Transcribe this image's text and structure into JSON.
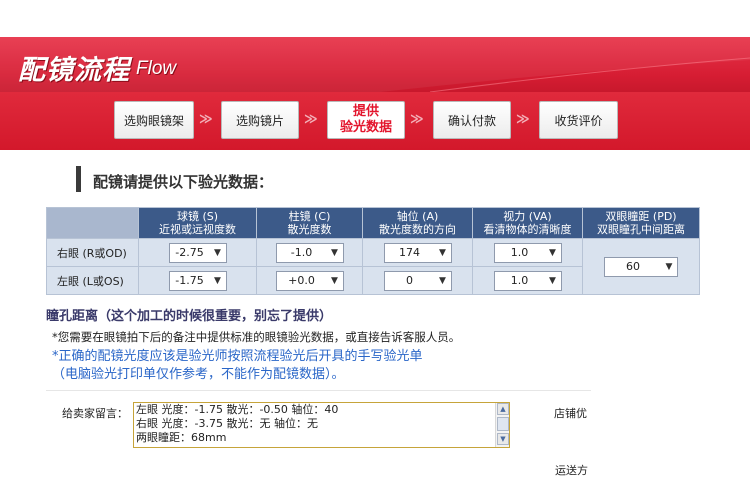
{
  "header": {
    "title": "配镜流程",
    "subtitle": "Flow",
    "colors": {
      "banner": "#d61d33",
      "active_step_text": "#e3152d"
    }
  },
  "steps": [
    {
      "label": "选购眼镜架",
      "active": false
    },
    {
      "label": "选购镜片",
      "active": false
    },
    {
      "label_line1": "提供",
      "label_line2": "验光数据",
      "active": true
    },
    {
      "label": "确认付款",
      "active": false
    },
    {
      "label": "收货评价",
      "active": false
    }
  ],
  "step_arrow": "≫",
  "section_title": "配镜请提供以下验光数据：",
  "table": {
    "columns": [
      {
        "line1": "球镜 (S)",
        "line2": "近视或远视度数"
      },
      {
        "line1": "柱镜 (C)",
        "line2": "散光度数"
      },
      {
        "line1": "轴位 (A)",
        "line2": "散光度数的方向"
      },
      {
        "line1": "视力 (VA)",
        "line2": "看清物体的清晰度"
      },
      {
        "line1": "双眼瞳距 (PD)",
        "line2": "双眼瞳孔中间距离"
      }
    ],
    "rows": [
      {
        "label": "右眼 (R或OD)",
        "sphere": "-2.75",
        "cylinder": "-1.0",
        "axis": "174",
        "va": "1.0"
      },
      {
        "label": "左眼 (L或OS)",
        "sphere": "-1.75",
        "cylinder": "+0.0",
        "axis": "0",
        "va": "1.0"
      }
    ],
    "pd_value": "60"
  },
  "pd_title": "瞳孔距离（这个加工的时候很重要，别忘了提供）",
  "notes": {
    "line1": "*您需要在眼镜拍下后的备注中提供标准的眼镜验光数据，或直接告诉客服人员。",
    "line2": "*正确的配镜光度应该是验光师按照流程验光后开具的手写验光单",
    "line3": "（电脑验光打印单仅作参考，不能作为配镜数据）。"
  },
  "message": {
    "label": "给卖家留言：",
    "lines": [
      "左眼 光度：-1.75 散光：-0.50 轴位：40",
      "右眼 光度：-3.75 散光：无 轴位：无",
      "两眼瞳距：68mm"
    ]
  },
  "side": {
    "shop_label": "店铺优",
    "shipping_label": "运送方"
  }
}
